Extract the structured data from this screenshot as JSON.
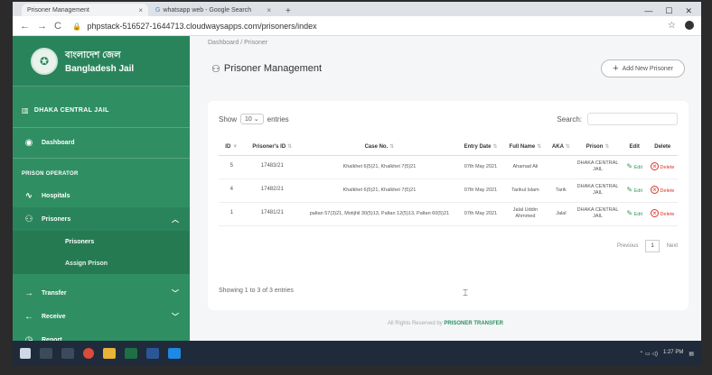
{
  "browser": {
    "tab1": "Prisoner Management",
    "tab2": "whatsapp web - Google Search",
    "url": "phpstack-516527-1644713.cloudwaysapps.com/prisoners/index"
  },
  "sidebar": {
    "logo_bn": "বাংলাদেশ জেল",
    "logo_en": "Bangladesh Jail",
    "jail_name": "DHAKA CENTRAL JAIL",
    "dashboard": "Dashboard",
    "section": "PRISON OPERATOR",
    "hospitals": "Hospitals",
    "prisoners": "Prisoners",
    "sub_prisoners": "Prisoners",
    "sub_assign": "Assign Prison",
    "transfer": "Transfer",
    "receive": "Receive",
    "report": "Report"
  },
  "breadcrumb": "Dashboard  /  Prisoner",
  "page": {
    "title": "Prisoner Management",
    "add_button": "Add New Prisoner"
  },
  "table": {
    "show": "Show",
    "entries": "entries",
    "length": "10",
    "search_label": "Search:",
    "headers": {
      "id": "ID",
      "prisoner_id": "Prisoner's ID",
      "case": "Case No.",
      "entry": "Entry Date",
      "name": "Full Name",
      "aka": "AKA",
      "prison": "Prison",
      "edit": "Edit",
      "delete": "Delete"
    },
    "rows": [
      {
        "id": "5",
        "pid": "17483/21",
        "case": "Khalkhet 6(5)21, Khalkhet 7(5)21",
        "entry": "07th May 2021",
        "name": "Ahamad Ali",
        "aka": "",
        "prison": "DHAKA CENTRAL JAIL"
      },
      {
        "id": "4",
        "pid": "17482/21",
        "case": "Khalkhet 6(5)21, Khalkhet 7(5)21",
        "entry": "07th May 2021",
        "name": "Tarikul Islam",
        "aka": "Tarik",
        "prison": "DHAKA CENTRAL JAIL"
      },
      {
        "id": "1",
        "pid": "17481/21",
        "case": "paltan 57(3)21, Motijhil 30(5)13, Paltan 12(5)13, Paltan 60(5)21",
        "entry": "07th May 2021",
        "name": "Jalal Uddin Ahmmed",
        "aka": "Jalal",
        "prison": "DHAKA CENTRAL JAIL"
      }
    ],
    "edit_label": "Edit",
    "delete_label": "Delete",
    "info": "Showing 1 to 3 of 3 entries",
    "previous": "Previous",
    "page": "1",
    "next": "Next"
  },
  "footer": {
    "prefix": "All Rights Reserved by",
    "brand": "PRISONER TRANSFER"
  },
  "taskbar": {
    "time": "1:27 PM"
  }
}
